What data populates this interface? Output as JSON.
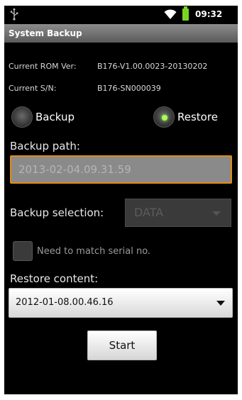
{
  "status_bar": {
    "time": "09:32",
    "icons": [
      "usb-icon",
      "wifi-icon",
      "battery-icon"
    ],
    "battery_color": "#7bd321"
  },
  "app": {
    "title": "System Backup"
  },
  "info": {
    "rom_label": "Current ROM Ver:",
    "rom_value": "B176-V1.00.0023-20130202",
    "sn_label": "Current S/N:",
    "sn_value": "B176-SN000039"
  },
  "mode": {
    "backup_label": "Backup",
    "restore_label": "Restore",
    "selected": "Restore"
  },
  "backup_path": {
    "label": "Backup path:",
    "value": "2013-02-04.09.31.59"
  },
  "backup_selection": {
    "label": "Backup selection:",
    "value": "DATA"
  },
  "serial_check": {
    "label": "Need to match serial no.",
    "checked": false
  },
  "restore_content": {
    "label": "Restore content:",
    "value": "2012-01-08.00.46.16"
  },
  "actions": {
    "start_label": "Start"
  },
  "colors": {
    "accent_focus": "#e08a18",
    "radio_selected": "#aaff55"
  }
}
